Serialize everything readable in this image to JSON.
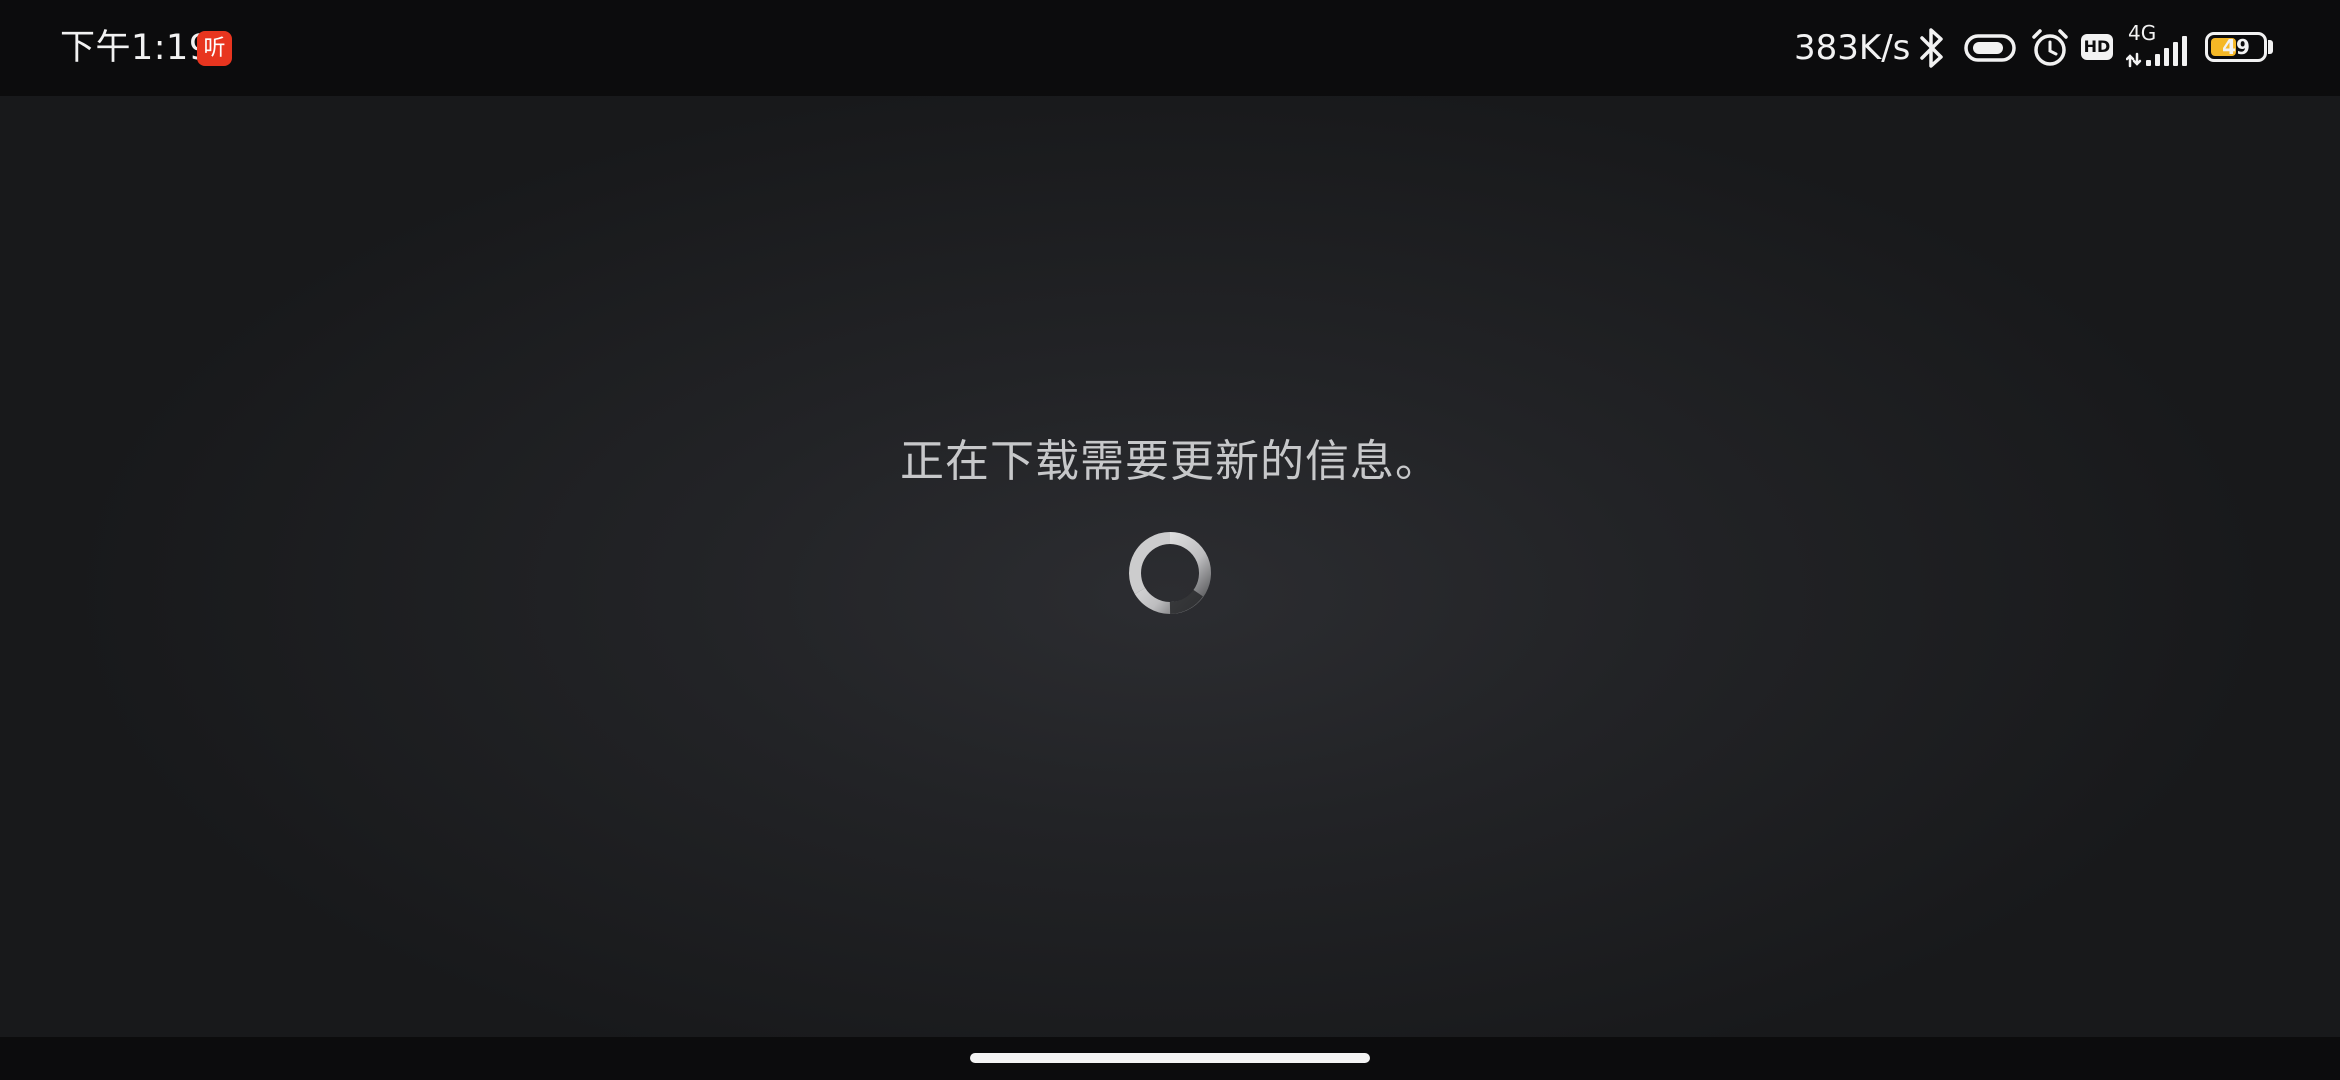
{
  "status_bar": {
    "time": "下午1:19",
    "app_badge": "听",
    "net_speed": "383K/s",
    "hd": "HD",
    "network_type": "4G",
    "battery_level": "49",
    "battery_fraction": 0.49,
    "icons": [
      "bluetooth-icon",
      "data-saver-icon",
      "alarm-icon",
      "hd-voice-icon",
      "signal-icon",
      "battery-icon"
    ]
  },
  "main": {
    "message": "正在下载需要更新的信息。"
  },
  "colors": {
    "background": "#222326",
    "status_bar": "#0c0c0d",
    "text": "#c7c8ca",
    "badge": "#e8351f",
    "battery_fill": "#f5b826"
  }
}
